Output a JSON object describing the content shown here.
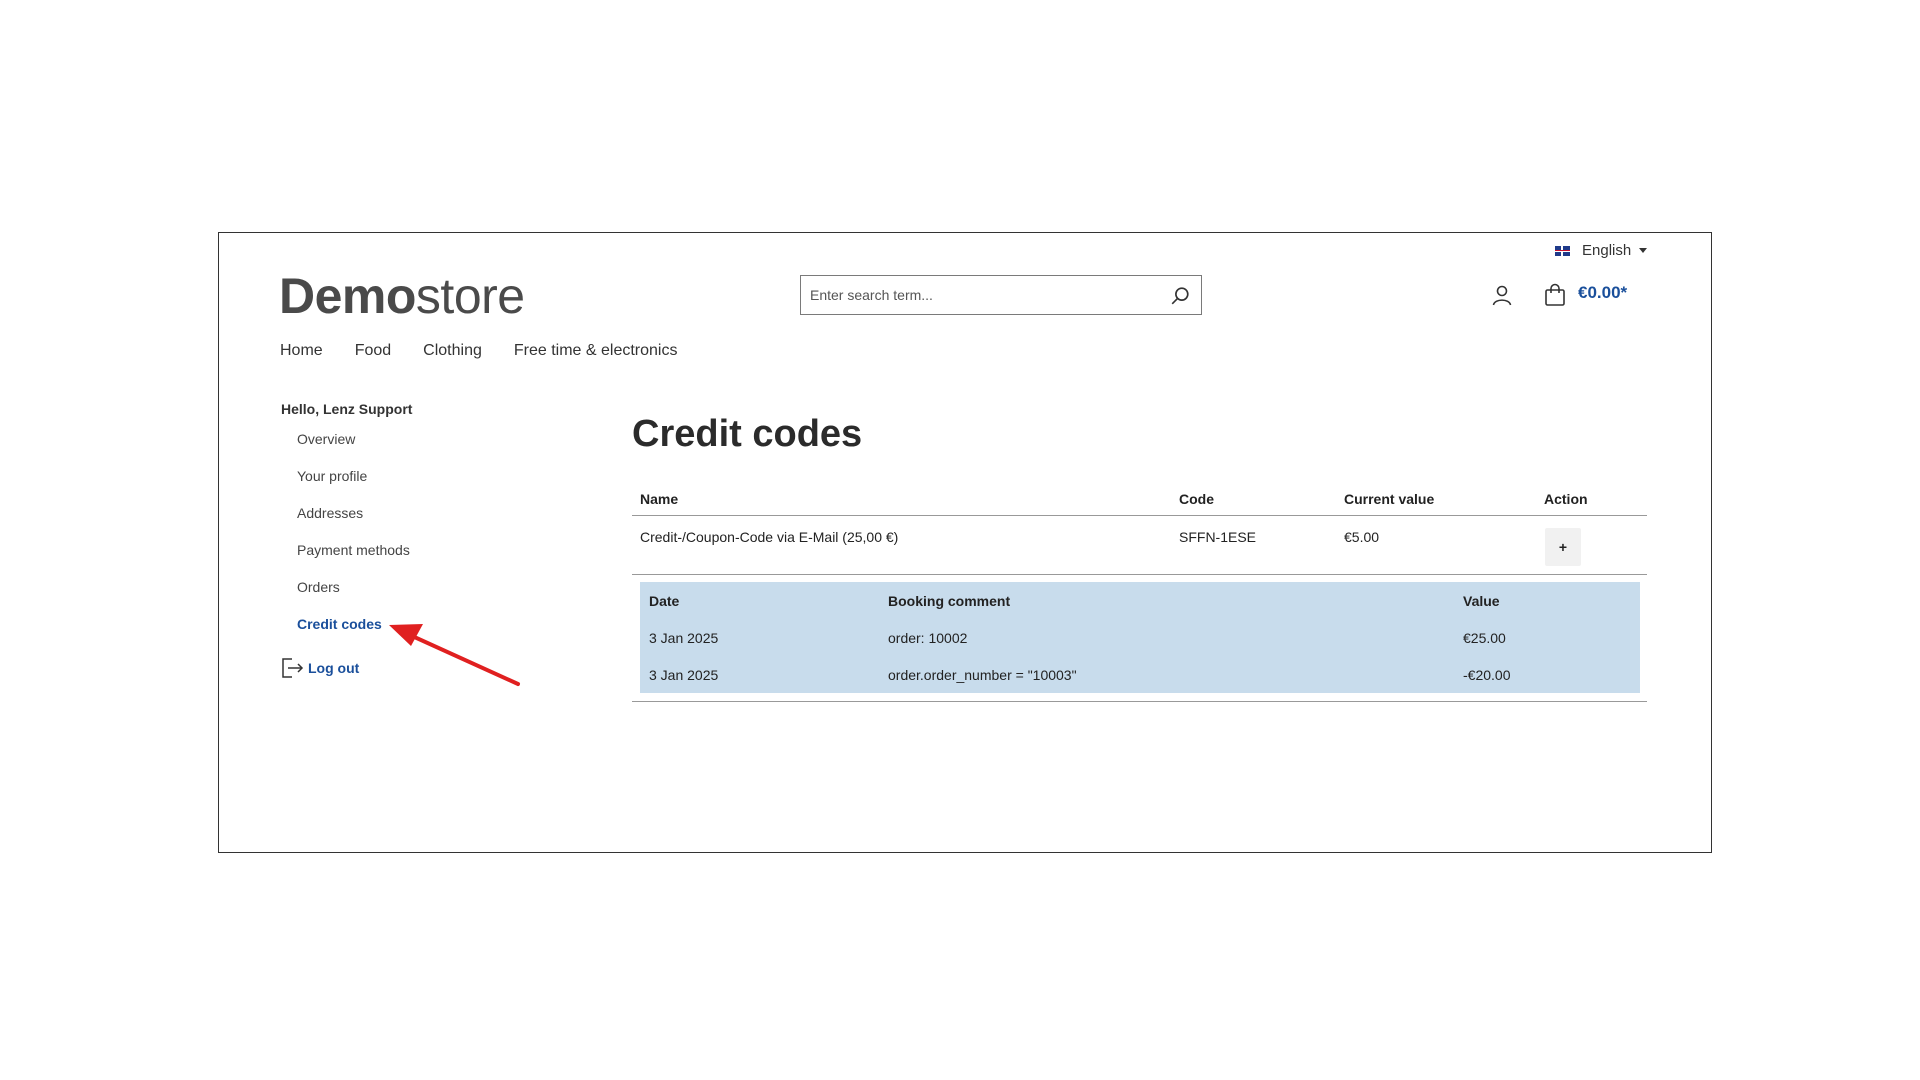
{
  "header": {
    "language": "English",
    "logo_bold": "Demo",
    "logo_regular": "store",
    "search_placeholder": "Enter search term...",
    "cart_total": "€0.00*"
  },
  "nav": [
    "Home",
    "Food",
    "Clothing",
    "Free time & electronics"
  ],
  "sidebar": {
    "greeting": "Hello, Lenz Support",
    "items": [
      {
        "label": "Overview"
      },
      {
        "label": "Your profile"
      },
      {
        "label": "Addresses"
      },
      {
        "label": "Payment methods"
      },
      {
        "label": "Orders"
      },
      {
        "label": "Credit codes",
        "active": true
      }
    ],
    "logout": "Log out"
  },
  "main": {
    "title": "Credit codes",
    "columns": {
      "name": "Name",
      "code": "Code",
      "current_value": "Current value",
      "action": "Action"
    },
    "row": {
      "name": "Credit-/Coupon-Code via E-Mail (25,00 €)",
      "code": "SFFN-1ESE",
      "current_value": "€5.00",
      "action_label": "+"
    },
    "detail": {
      "columns": {
        "date": "Date",
        "comment": "Booking comment",
        "value": "Value"
      },
      "rows": [
        {
          "date": "3 Jan 2025",
          "comment": "order: 10002",
          "value": "€25.00"
        },
        {
          "date": "3 Jan 2025",
          "comment": "order.order_number = \"10003\"",
          "value": "-€20.00"
        }
      ]
    }
  },
  "colors": {
    "accent": "#1a4f9b",
    "detail_bg": "#c8dcec",
    "annotation_arrow": "#e02020"
  }
}
